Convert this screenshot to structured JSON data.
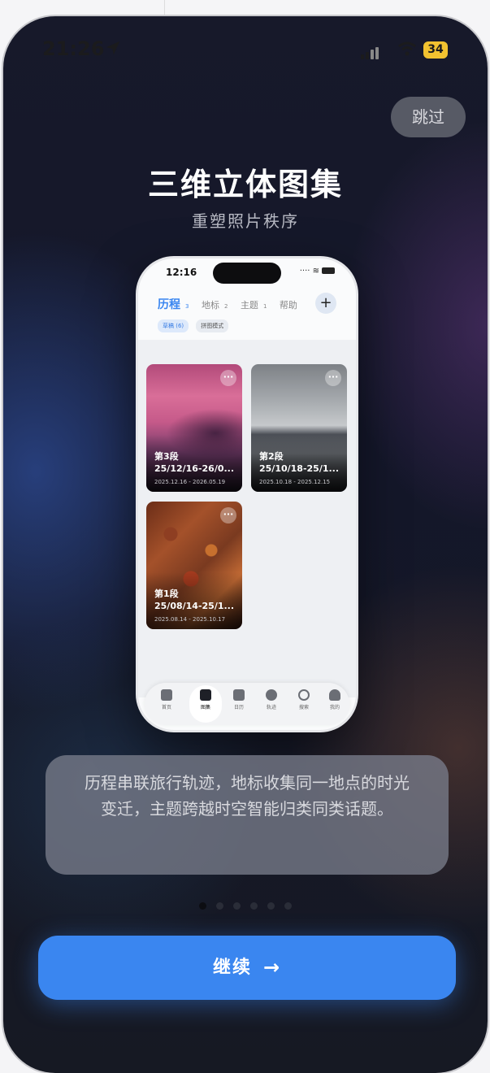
{
  "status_bar": {
    "time": "21:26",
    "battery": "34"
  },
  "skip_label": "跳过",
  "title": "三维立体图集",
  "subtitle": "重塑照片秩序",
  "mock": {
    "time": "12:16",
    "tabs": [
      {
        "label": "历程",
        "count": "3"
      },
      {
        "label": "地标",
        "count": "2"
      },
      {
        "label": "主题",
        "count": "1"
      },
      {
        "label": "帮助",
        "count": ""
      }
    ],
    "add_label": "+",
    "chips": [
      "草稿 (6)",
      "拼图模式"
    ],
    "cards": [
      {
        "segment": "第3段",
        "range": "25/12/16-26/0...",
        "dates": "2025.12.16 - 2026.05.19"
      },
      {
        "segment": "第2段",
        "range": "25/10/18-25/1...",
        "dates": "2025.10.18 - 2025.12.15"
      },
      {
        "segment": "第1段",
        "range": "25/08/14-25/1...",
        "dates": "2025.08.14 - 2025.10.17"
      }
    ],
    "more_label": "···",
    "nav": [
      "首页",
      "图集",
      "日历",
      "轨迹",
      "搜索",
      "我的"
    ]
  },
  "description": "历程串联旅行轨迹，地标收集同一地点的时光变迁，主题跨越时空智能归类同类话题。",
  "pagination": {
    "total": 6,
    "current": 1
  },
  "cta_label": "继续",
  "cta_arrow": "→",
  "colors": {
    "accent": "#3a86f0",
    "battery": "#f2c230"
  }
}
